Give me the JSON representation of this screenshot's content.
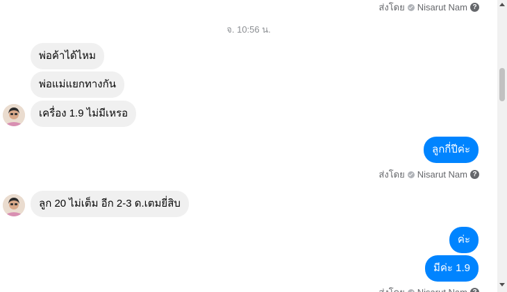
{
  "chat": {
    "sent_by_label": "ส่งโดย",
    "sender_name": "Nisarut Nam",
    "help_glyph": "?",
    "timestamp": "จ. 10:56 น.",
    "incoming_1": [
      "พ่อค้าได้ไหม",
      "พ่อแม่แยกทางกัน",
      "เครื่อง 1.9 ไม่มีเหรอ"
    ],
    "outgoing_1": "ลูกกี่ปีค่ะ",
    "incoming_2": "ลูก 20 ไม่เต็ม อีก 2-3 ด.เตมยี่สิบ",
    "outgoing_2": [
      "ค่ะ",
      "มีค่ะ 1.9"
    ]
  }
}
